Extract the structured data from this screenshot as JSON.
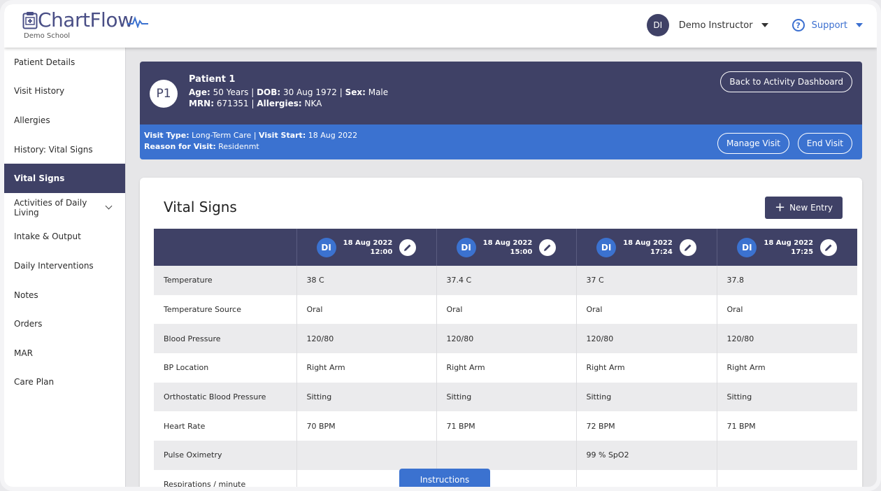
{
  "header": {
    "logo_text": "ChartFlow",
    "school": "Demo School",
    "user_initials": "DI",
    "user_name": "Demo Instructor",
    "support_label": "Support"
  },
  "sidebar": {
    "items": [
      {
        "label": "Patient Details"
      },
      {
        "label": "Visit History"
      },
      {
        "label": "Allergies"
      },
      {
        "label": "History: Vital Signs"
      },
      {
        "label": "Vital Signs"
      },
      {
        "label": "Activities of Daily Living"
      },
      {
        "label": "Intake & Output"
      },
      {
        "label": "Daily Interventions"
      },
      {
        "label": "Notes"
      },
      {
        "label": "Orders"
      },
      {
        "label": "MAR"
      },
      {
        "label": "Care Plan"
      }
    ],
    "active": "Vital Signs"
  },
  "patient": {
    "badge": "P1",
    "name": "Patient 1",
    "age_label": "Age:",
    "age": "50 Years",
    "dob_label": "DOB:",
    "dob": "30 Aug 1972",
    "sex_label": "Sex:",
    "sex": "Male",
    "mrn_label": "MRN:",
    "mrn": "671351",
    "allergies_label": "Allergies:",
    "allergies": "NKA",
    "back_button": "Back to Activity Dashboard"
  },
  "visit": {
    "type_label": "Visit Type:",
    "type": "Long-Term Care",
    "start_label": "Visit Start:",
    "start": "18 Aug 2022",
    "reason_label": "Reason for Visit:",
    "reason": "Residenmt",
    "manage_button": "Manage Visit",
    "end_button": "End Visit"
  },
  "vitals": {
    "title": "Vital Signs",
    "new_entry": "New Entry",
    "columns": [
      {
        "initials": "DI",
        "date": "18 Aug 2022",
        "time": "12:00"
      },
      {
        "initials": "DI",
        "date": "18 Aug 2022",
        "time": "15:00"
      },
      {
        "initials": "DI",
        "date": "18 Aug 2022",
        "time": "17:24"
      },
      {
        "initials": "DI",
        "date": "18 Aug 2022",
        "time": "17:25"
      }
    ],
    "rows": [
      {
        "label": "Temperature",
        "values": [
          "38 C",
          "37.4 C",
          "37 C",
          "37.8"
        ]
      },
      {
        "label": "Temperature Source",
        "values": [
          "Oral",
          "Oral",
          "Oral",
          "Oral"
        ]
      },
      {
        "label": "Blood Pressure",
        "values": [
          "120/80",
          "120/80",
          "120/80",
          "120/80"
        ]
      },
      {
        "label": "BP Location",
        "values": [
          "Right Arm",
          "Right Arm",
          "Right Arm",
          "Right Arm"
        ]
      },
      {
        "label": "Orthostatic Blood Pressure",
        "values": [
          "Sitting",
          "Sitting",
          "Sitting",
          "Sitting"
        ]
      },
      {
        "label": "Heart Rate",
        "values": [
          "70 BPM",
          "71 BPM",
          "72 BPM",
          "71 BPM"
        ]
      },
      {
        "label": "Pulse Oximetry",
        "values": [
          "",
          "",
          "99 % SpO2",
          ""
        ]
      },
      {
        "label": "Respirations / minute",
        "values": [
          "",
          "",
          "",
          ""
        ]
      }
    ]
  },
  "instructions_label": "Instructions",
  "colors": {
    "navy": "#3f4166",
    "blue": "#3b72d0",
    "logo": "#4a4f86"
  }
}
